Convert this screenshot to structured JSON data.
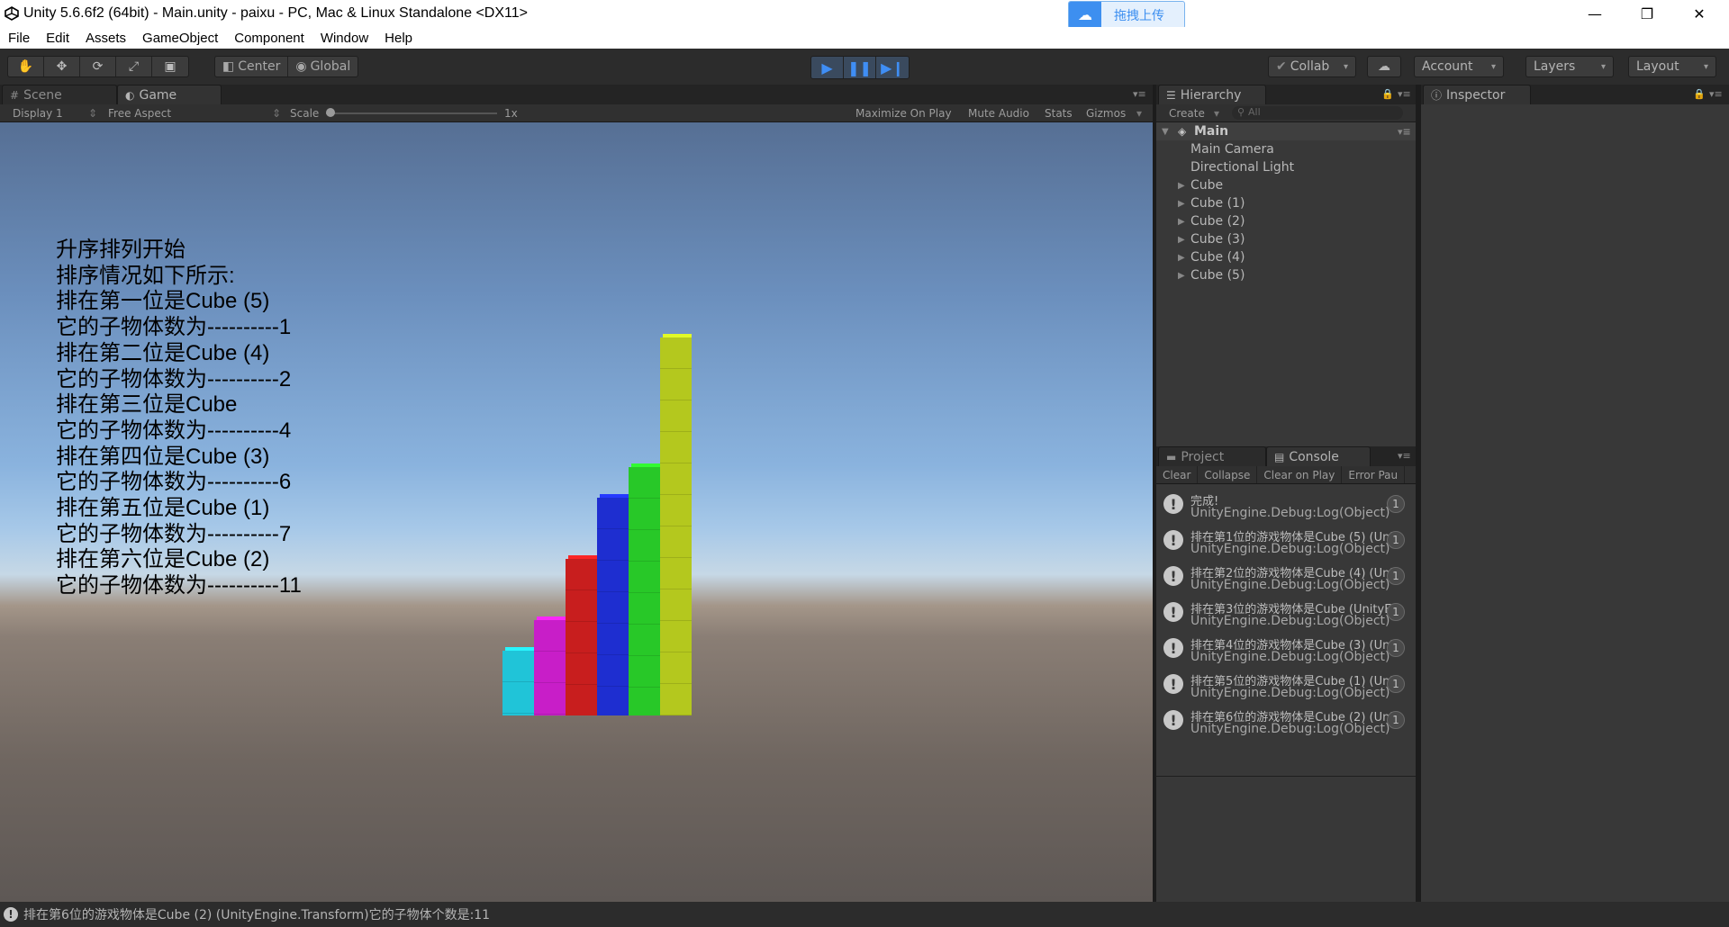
{
  "window": {
    "title": "Unity 5.6.6f2 (64bit) - Main.unity - paixu - PC, Mac & Linux Standalone <DX11>",
    "upload_label": "拖拽上传",
    "minimize": "—",
    "restore": "❐",
    "close": "✕"
  },
  "menu": [
    "File",
    "Edit",
    "Assets",
    "GameObject",
    "Component",
    "Window",
    "Help"
  ],
  "toolbar": {
    "tools": [
      "hand-icon",
      "move-icon",
      "rotate-icon",
      "scale-icon",
      "rect-icon"
    ],
    "pivot_label": "Center",
    "space_label": "Global",
    "collab_label": "Collab",
    "account_label": "Account",
    "layers_label": "Layers",
    "layout_label": "Layout"
  },
  "tabs": {
    "scene": "Scene",
    "game": "Game",
    "hierarchy": "Hierarchy",
    "inspector": "Inspector",
    "project": "Project",
    "console": "Console"
  },
  "gamebar": {
    "display": "Display 1",
    "aspect": "Free Aspect",
    "scale_label": "Scale",
    "scale_value": "1x",
    "maximize": "Maximize On Play",
    "mute": "Mute Audio",
    "stats": "Stats",
    "gizmos": "Gizmos"
  },
  "game_text": [
    "升序排列开始",
    "排序情况如下所示:",
    "排在第一位是Cube (5)",
    "它的子物体数为----------1",
    "排在第二位是Cube (4)",
    "它的子物体数为----------2",
    "排在第三位是Cube",
    "它的子物体数为----------4",
    "排在第四位是Cube (3)",
    "它的子物体数为----------6",
    "排在第五位是Cube (1)",
    "它的子物体数为----------7",
    "排在第六位是Cube (2)",
    "它的子物体数为----------11"
  ],
  "cubes": [
    {
      "color": "#20c4d8",
      "level": 0.18
    },
    {
      "color": "#c81ec8",
      "level": 0.26
    },
    {
      "color": "#c81e1e",
      "level": 0.42
    },
    {
      "color": "#1e2ed0",
      "level": 0.58
    },
    {
      "color": "#28c828",
      "level": 0.66
    },
    {
      "color": "#b4c81e",
      "level": 1.0
    }
  ],
  "hierarchy": {
    "create_label": "Create",
    "search_placeholder": "All",
    "scene_name": "Main",
    "items": [
      "Main Camera",
      "Directional Light",
      "Cube",
      "Cube (1)",
      "Cube (2)",
      "Cube (3)",
      "Cube (4)",
      "Cube (5)"
    ]
  },
  "console": {
    "buttons": [
      "Clear",
      "Collapse",
      "Clear on Play",
      "Error Pau"
    ],
    "logs": [
      {
        "line1": "完成!",
        "line2": "UnityEngine.Debug:Log(Object)",
        "count": "1"
      },
      {
        "line1": "排在第1位的游戏物体是Cube (5) (Unit",
        "line2": "UnityEngine.Debug:Log(Object)",
        "count": "1"
      },
      {
        "line1": "排在第2位的游戏物体是Cube (4) (Unit",
        "line2": "UnityEngine.Debug:Log(Object)",
        "count": "1"
      },
      {
        "line1": "排在第3位的游戏物体是Cube (UnityEn",
        "line2": "UnityEngine.Debug:Log(Object)",
        "count": "1"
      },
      {
        "line1": "排在第4位的游戏物体是Cube (3) (Unit",
        "line2": "UnityEngine.Debug:Log(Object)",
        "count": "1"
      },
      {
        "line1": "排在第5位的游戏物体是Cube (1) (Unit",
        "line2": "UnityEngine.Debug:Log(Object)",
        "count": "1"
      },
      {
        "line1": "排在第6位的游戏物体是Cube (2) (Unit",
        "line2": "UnityEngine.Debug:Log(Object)",
        "count": "1"
      }
    ]
  },
  "status": "排在第6位的游戏物体是Cube (2) (UnityEngine.Transform)它的子物体个数是:11"
}
